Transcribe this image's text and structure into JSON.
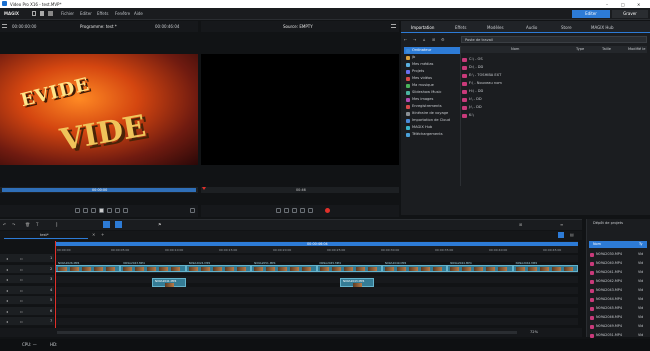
{
  "titlebar": {
    "title": "Video Pro X16 - test.MVP*"
  },
  "menubar": {
    "brand": "MAGIX",
    "items": [
      "Fichier",
      "Editer",
      "Effets",
      "Fenêtre",
      "Aide"
    ],
    "mode_edit": "Editer",
    "mode_export": "Graver"
  },
  "program": {
    "time_left": "00:00:00:00",
    "title": "Programme: test *",
    "time_right": "00:00:46:04",
    "scrub_time": "00:00:00"
  },
  "source": {
    "title": "Source: EMPTY",
    "scrub_time": "00:46"
  },
  "right_panel": {
    "tabs": [
      "Importation",
      "Effets",
      "Modèles",
      "Audio",
      "Store",
      "MAGIX Hub"
    ],
    "path": "Poste de travail",
    "columns": [
      "Nom",
      "Type",
      "Taille",
      "Modifié le"
    ],
    "sources": [
      {
        "label": "Ordinateur",
        "color": "#3d8bd9"
      },
      {
        "label": "jb",
        "color": "#d9a13d"
      },
      {
        "label": "Mes médias",
        "color": "#5bb0e0"
      },
      {
        "label": "Projets",
        "color": "#6a6ff0"
      },
      {
        "label": "Mes vidéos",
        "color": "#d94a4a"
      },
      {
        "label": "Ma musique",
        "color": "#4ab35b"
      },
      {
        "label": "Slideshow Music",
        "color": "#4ab3a0"
      },
      {
        "label": "Mes images",
        "color": "#b34ab0"
      },
      {
        "label": "Enregistrements",
        "color": "#d94a4a"
      },
      {
        "label": "Itinéraire de voyage",
        "color": "#8a8f95"
      },
      {
        "label": "Importation de Cloud",
        "color": "#4a8ad9"
      },
      {
        "label": "MAGIX Hub",
        "color": "#3ab3c9"
      },
      {
        "label": "Téléchargements",
        "color": "#4aa0d9"
      }
    ],
    "files": [
      "C:\\ - OS",
      "D:\\ - DD",
      "E:\\ - TOSHIBA EXT",
      "F:\\ - Nouveau nom",
      "H:\\ - DD",
      "I:\\ - DD",
      "J:\\ - DD",
      "K:\\"
    ]
  },
  "timeline": {
    "tab": "test*",
    "duration_label": "00:00:46:04",
    "ruler": [
      "00:00:00",
      "00:00:05:00",
      "00:00:10:00",
      "00:00:15:00",
      "00:00:20:00",
      "00:00:25:00",
      "00:00:30:00",
      "00:00:35:00",
      "00:00:40:00",
      "00:00:45:00"
    ],
    "clip_labels": [
      "N09A2026.MP4",
      "N09A2043.MP4",
      "N09A2024.MP4",
      "N09A2051.MP4",
      "N09A2045.MP4",
      "N09A2049.MP4",
      "N09A2044.MP4",
      "N09A2042.MP4"
    ],
    "track_numbers": [
      "1",
      "2",
      "3",
      "4",
      "5",
      "6",
      "7"
    ],
    "overlay_clip_1": "N09A2041.MP4",
    "overlay_clip_2": "N09A2043.MP4",
    "zoom": "72%"
  },
  "project_items": {
    "title": "Dépôt de projets",
    "columns": [
      "Nom",
      "Ty"
    ],
    "items": [
      "N09A2030.MP4",
      "N09A2040.MP4",
      "N09A2041.MP4",
      "N09A2042.MP4",
      "N09A2043.MP4",
      "N09A2044.MP4",
      "N09A2045.MP4",
      "N09A2046.MP4",
      "N09A2049.MP4",
      "N09A2051.MP4"
    ],
    "type": "Vid"
  },
  "statusbar": {
    "cpu": "CPU: —",
    "disk": "HD:"
  }
}
